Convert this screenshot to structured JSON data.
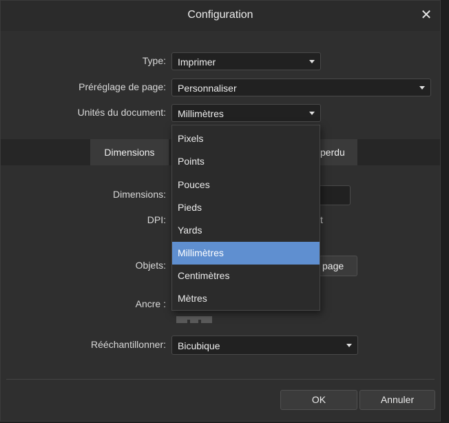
{
  "dialog": {
    "title": "Configuration"
  },
  "fields": {
    "type": {
      "label": "Type:",
      "value": "Imprimer"
    },
    "preset": {
      "label": "Préréglage de page:",
      "value": "Personnaliser"
    },
    "units": {
      "label": "Unités du document:",
      "value": "Millimètres"
    },
    "resample": {
      "label": "Rééchantillonner:",
      "value": "Bicubique"
    }
  },
  "tabs": {
    "active": "Dimensions",
    "partial": "perdu"
  },
  "page": {
    "dimensions_label": "Dimensions:",
    "dpi_label": "DPI:",
    "dpi_suffix": "t",
    "objects_label": "Objets:",
    "objects_button": "page",
    "anchor_label": "Ancre :"
  },
  "dropdown": {
    "options": [
      "Pixels",
      "Points",
      "Pouces",
      "Pieds",
      "Yards",
      "Millimètres",
      "Centimètres",
      "Mètres"
    ],
    "selected": "Millimètres"
  },
  "buttons": {
    "ok": "OK",
    "cancel": "Annuler"
  },
  "colors": {
    "highlight": "#5f8fd0",
    "background": "#2f2f2f"
  }
}
